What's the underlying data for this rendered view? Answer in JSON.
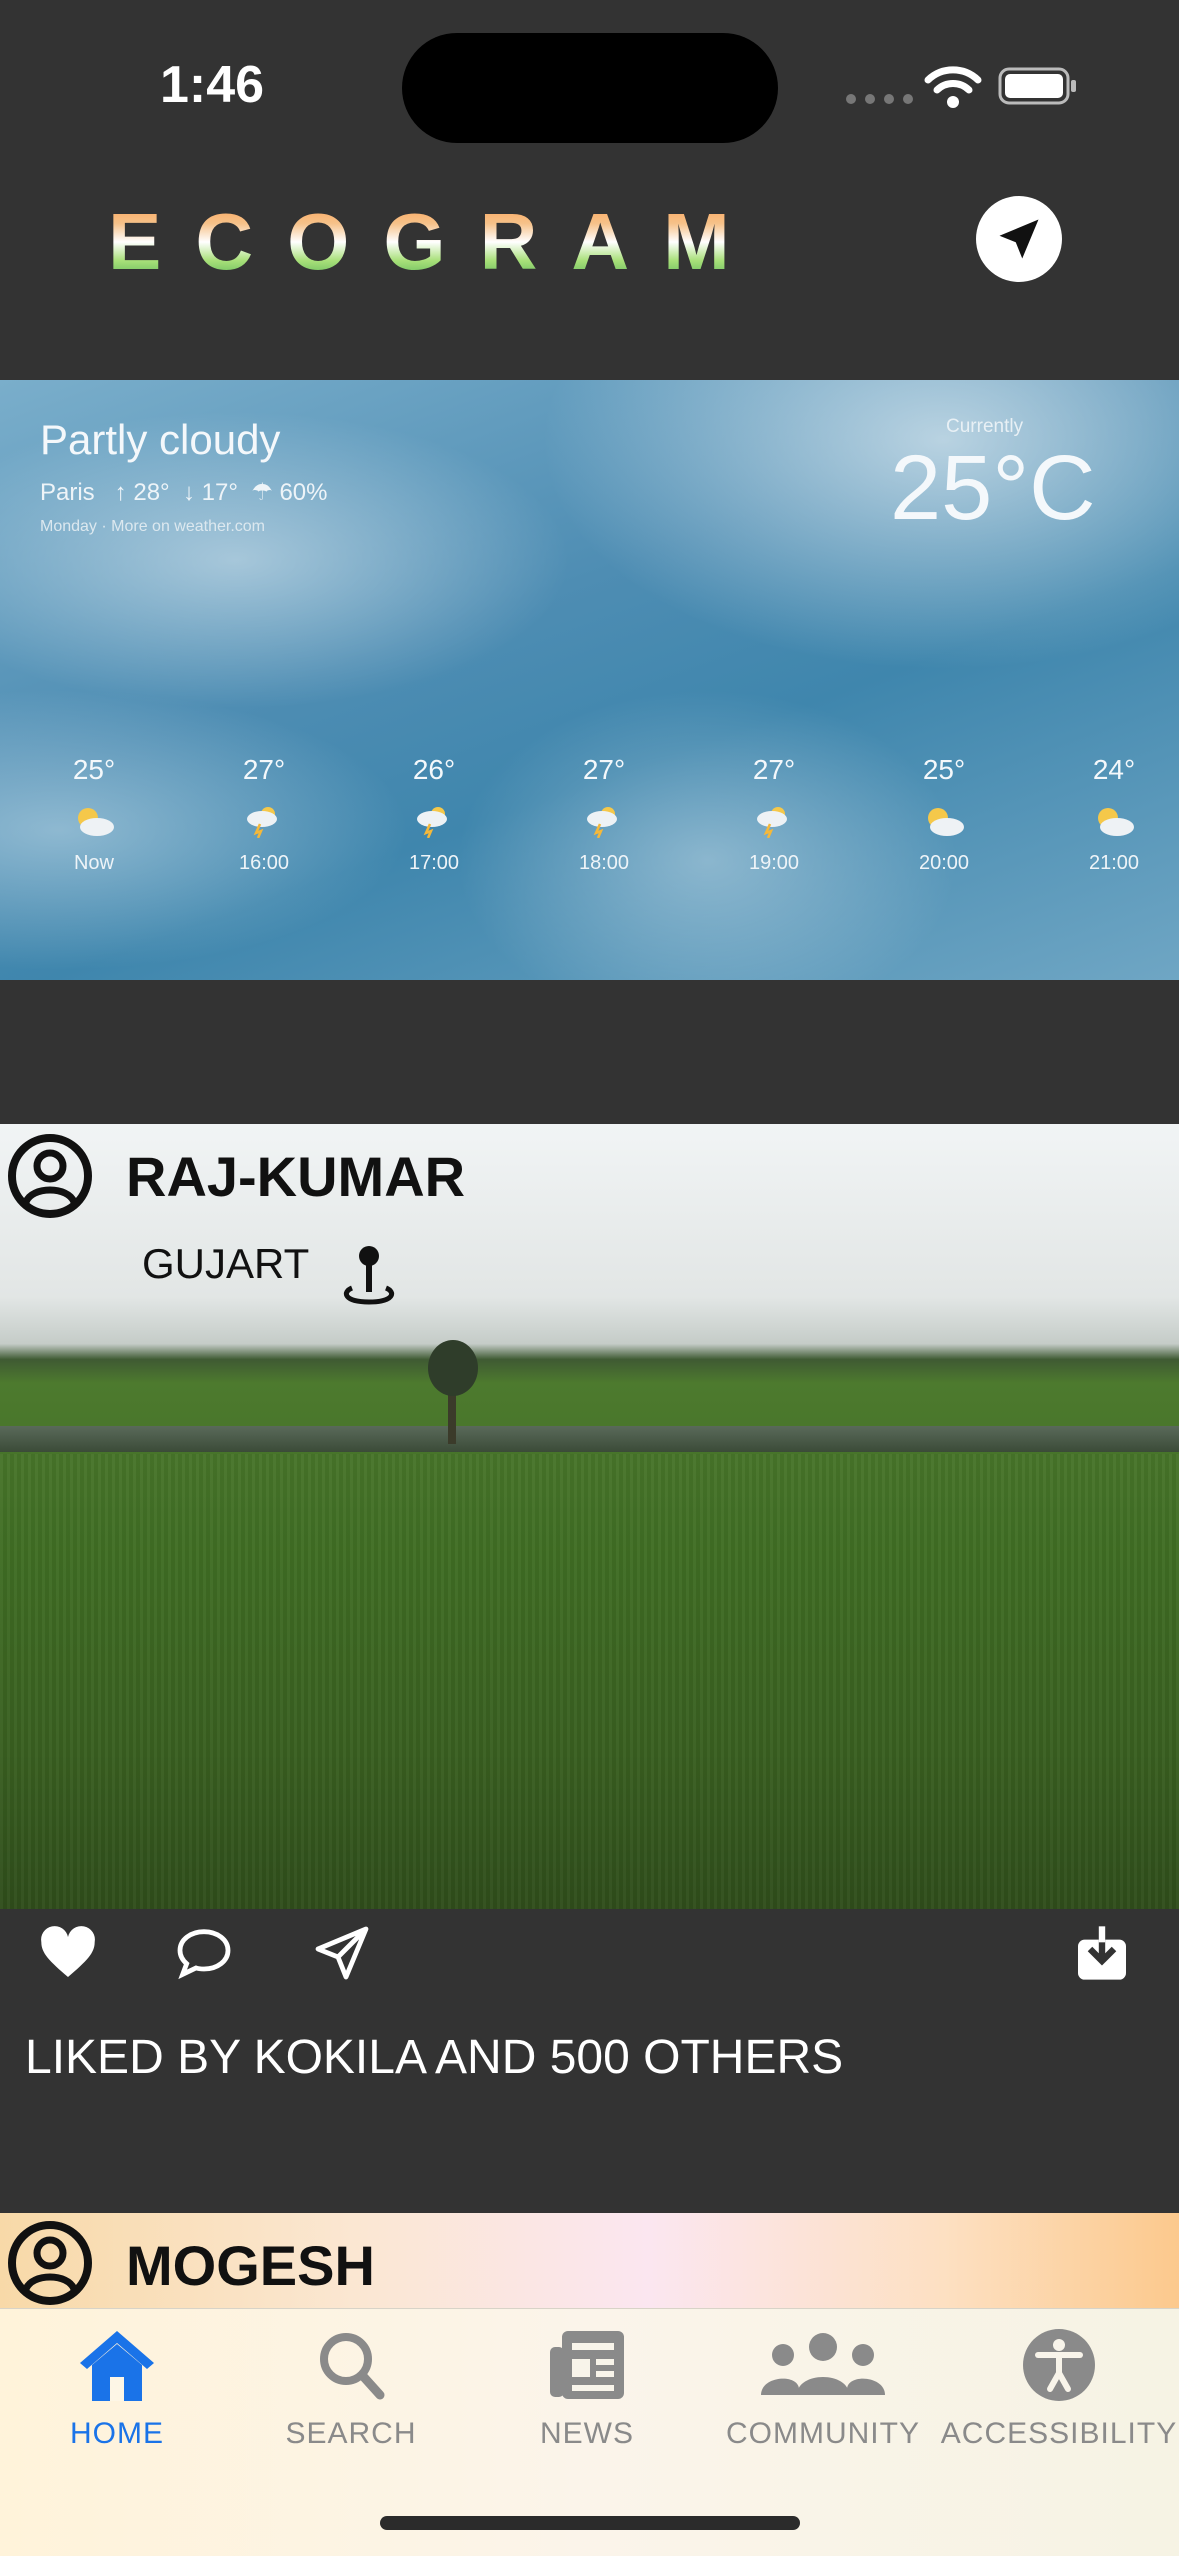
{
  "status_bar": {
    "time": "1:46"
  },
  "header": {
    "app_title": "ECOGRAM",
    "send_icon": "paper-plane-icon"
  },
  "weather": {
    "condition": "Partly cloudy",
    "meta": "Paris   ↑ 28°  ↓ 17°  ☂ 60%",
    "source": "Monday · More on weather.com",
    "currently_label": "Currently",
    "temperature": "25°C",
    "hourly": [
      {
        "temp": "25°",
        "time": "Now",
        "icon": "partly-sunny-icon"
      },
      {
        "temp": "27°",
        "time": "16:00",
        "icon": "thunder-cloud-icon"
      },
      {
        "temp": "26°",
        "time": "17:00",
        "icon": "thunder-cloud-icon"
      },
      {
        "temp": "27°",
        "time": "18:00",
        "icon": "thunder-cloud-icon"
      },
      {
        "temp": "27°",
        "time": "19:00",
        "icon": "thunder-cloud-icon"
      },
      {
        "temp": "25°",
        "time": "20:00",
        "icon": "partly-sunny-icon"
      },
      {
        "temp": "24°",
        "time": "21:00",
        "icon": "partly-sunny-icon"
      }
    ]
  },
  "posts": [
    {
      "user": "RAJ-KUMAR",
      "location": "GUJART",
      "likes_text": "LIKED BY KOKILA AND 500 OTHERS"
    },
    {
      "user": "MOGESH"
    }
  ],
  "tabs": [
    {
      "label": "HOME",
      "icon": "home-icon",
      "active": true
    },
    {
      "label": "SEARCH",
      "icon": "search-icon",
      "active": false
    },
    {
      "label": "NEWS",
      "icon": "newspaper-icon",
      "active": false
    },
    {
      "label": "COMMUNITY",
      "icon": "community-icon",
      "active": false
    },
    {
      "label": "ACCESSIBILITY",
      "icon": "accessibility-icon",
      "active": false
    }
  ],
  "colors": {
    "background": "#333333",
    "active_tab": "#1a73e8",
    "inactive_tab": "#8a8a8a"
  }
}
